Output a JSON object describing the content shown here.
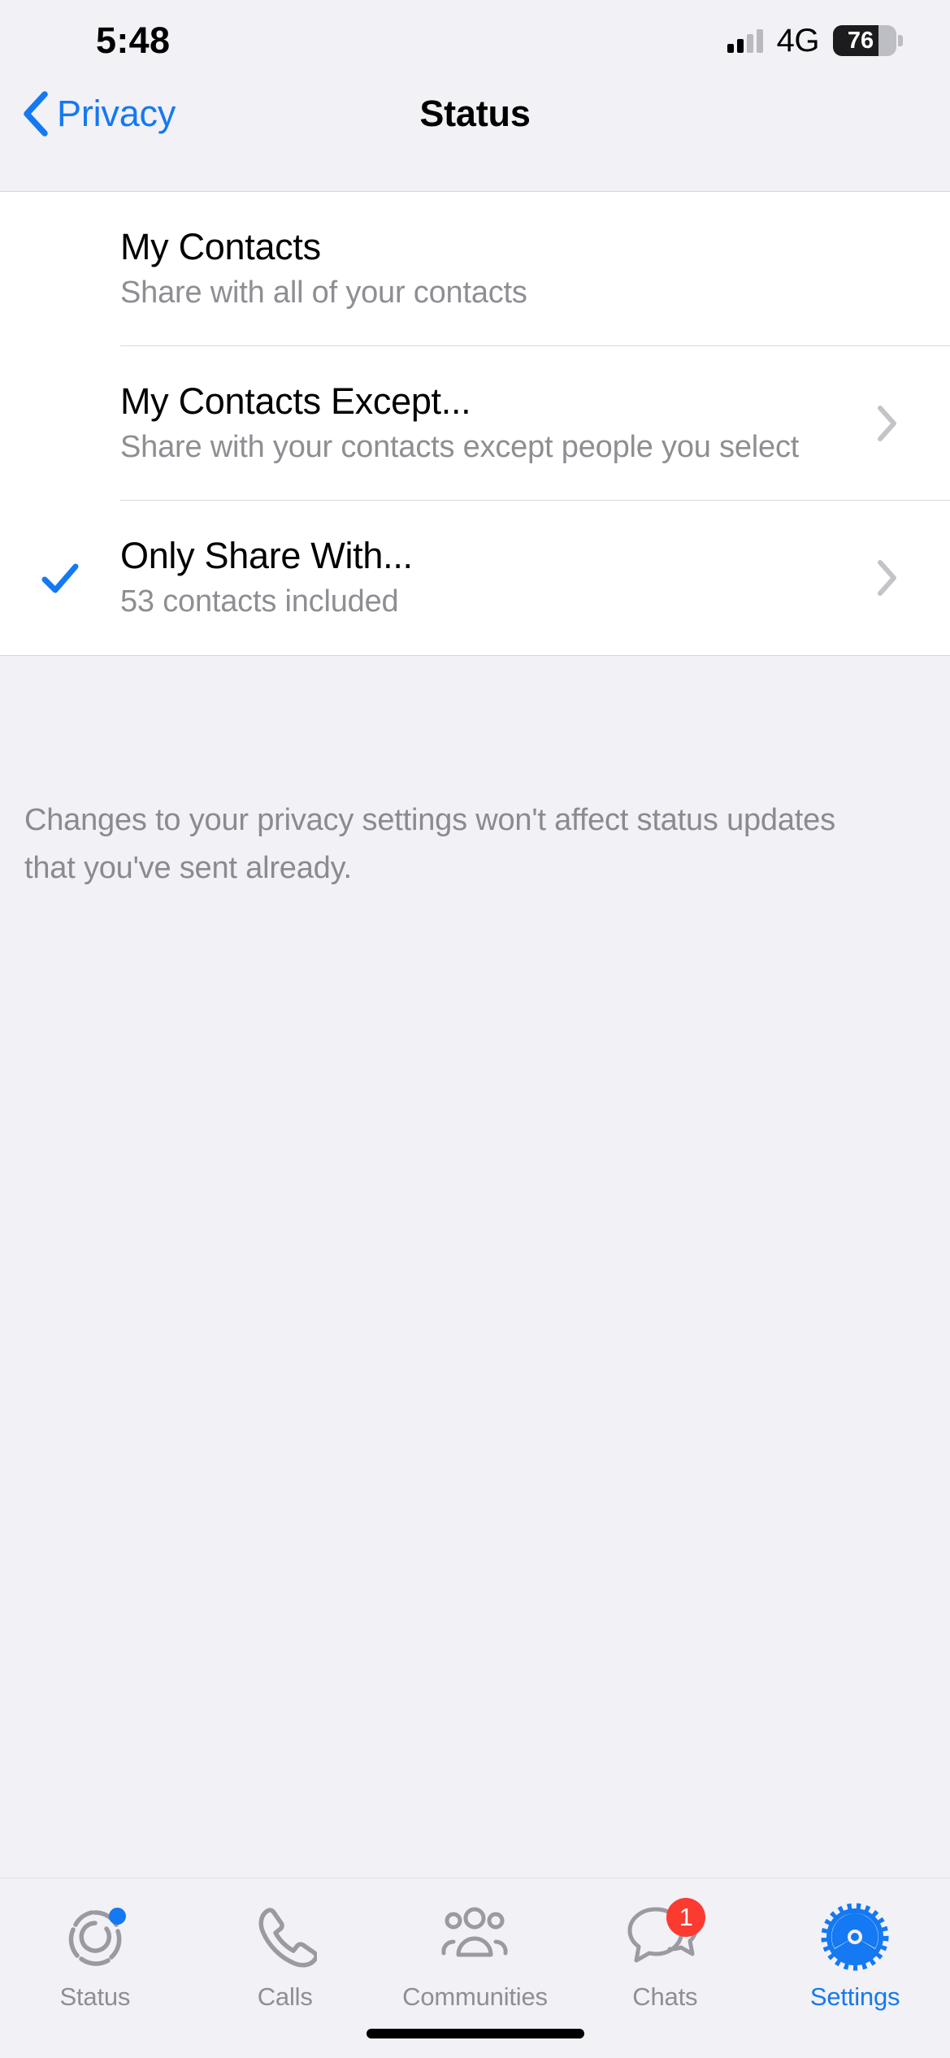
{
  "status_bar": {
    "time": "5:48",
    "network_type": "4G",
    "battery_level": "76",
    "signal_icon": "signal-bars-icon",
    "battery_icon": "battery-icon"
  },
  "navbar": {
    "back_label": "Privacy",
    "back_icon": "chevron-left-icon",
    "title": "Status"
  },
  "list": {
    "rows": [
      {
        "title": "My Contacts",
        "subtitle": "Share with all of your contacts",
        "selected": false,
        "has_chevron": false
      },
      {
        "title": "My Contacts Except...",
        "subtitle": "Share with your contacts except people you select",
        "selected": false,
        "has_chevron": true
      },
      {
        "title": "Only Share With...",
        "subtitle": "53 contacts included",
        "selected": true,
        "has_chevron": true
      }
    ]
  },
  "footer": {
    "note": "Changes to your privacy settings won't affect status updates that you've sent already."
  },
  "tabbar": {
    "tabs": [
      {
        "label": "Status",
        "icon": "status-ring-icon",
        "active": false,
        "dot": true,
        "badge": ""
      },
      {
        "label": "Calls",
        "icon": "phone-icon",
        "active": false,
        "dot": false,
        "badge": ""
      },
      {
        "label": "Communities",
        "icon": "communities-icon",
        "active": false,
        "dot": false,
        "badge": ""
      },
      {
        "label": "Chats",
        "icon": "chat-bubbles-icon",
        "active": false,
        "dot": false,
        "badge": "1"
      },
      {
        "label": "Settings",
        "icon": "gear-icon",
        "active": true,
        "dot": false,
        "badge": ""
      }
    ]
  },
  "colors": {
    "accent_blue": "#1479f2",
    "badge_red": "#fc3b30",
    "secondary_text": "#8e8e93",
    "page_background": "#f2f1f6",
    "card_background": "#ffffff"
  }
}
